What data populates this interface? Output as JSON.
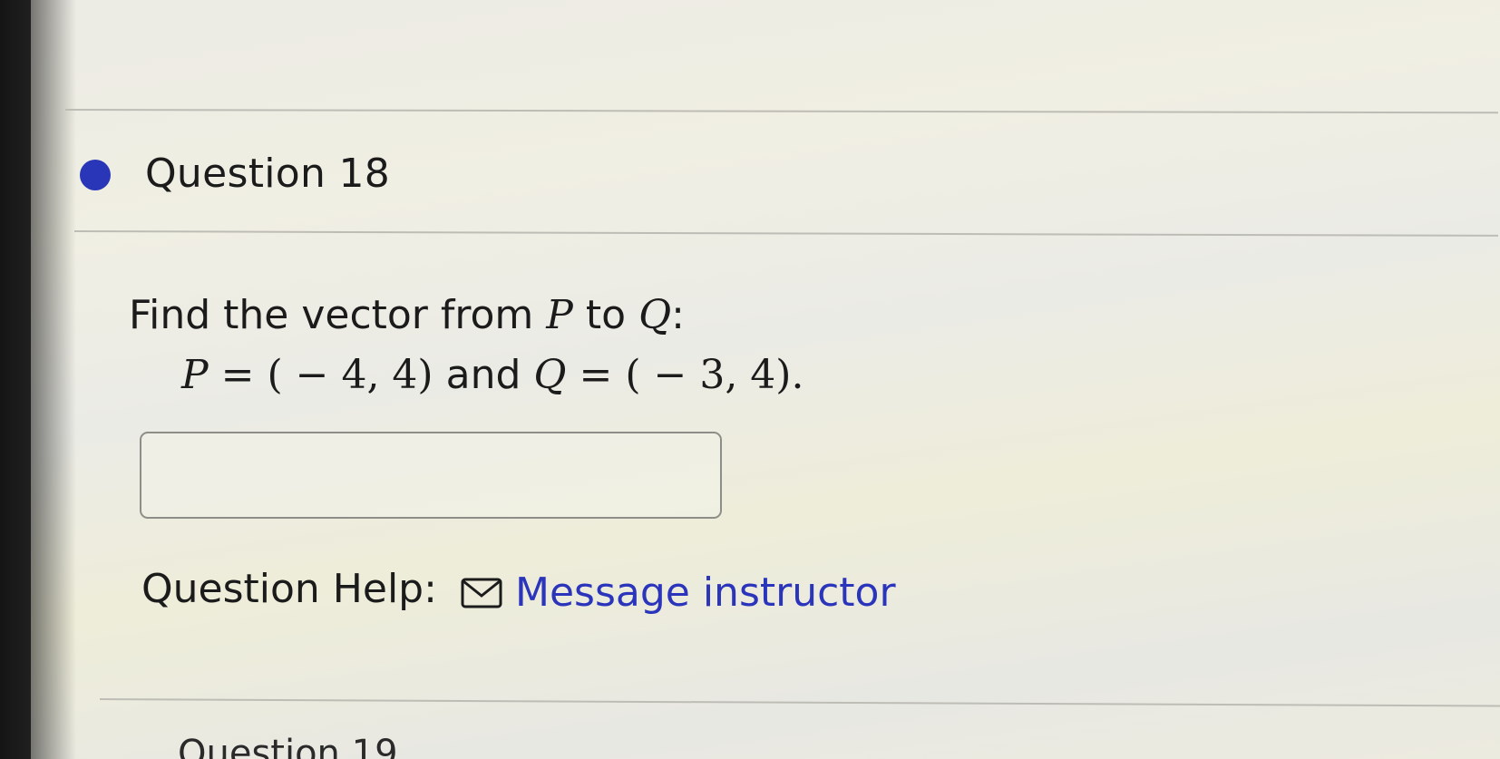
{
  "question": {
    "title": "Question 18",
    "status_color": "#2a36b8",
    "prompt_text": "Find the vector from",
    "prompt_point_p": "P",
    "prompt_to": "to",
    "prompt_point_q": "Q",
    "prompt_colon": ":",
    "given": {
      "p_label": "P",
      "p_value": "= ( − 4, 4)",
      "and": "and",
      "q_label": "Q",
      "q_value": "= ( − 3, 4)."
    },
    "answer_value": "",
    "answer_placeholder": ""
  },
  "help": {
    "label": "Question Help:",
    "icon": "mail-icon",
    "link_text": "Message instructor",
    "link_color": "#2b35bb"
  },
  "next_question": {
    "title": "Question 19"
  }
}
